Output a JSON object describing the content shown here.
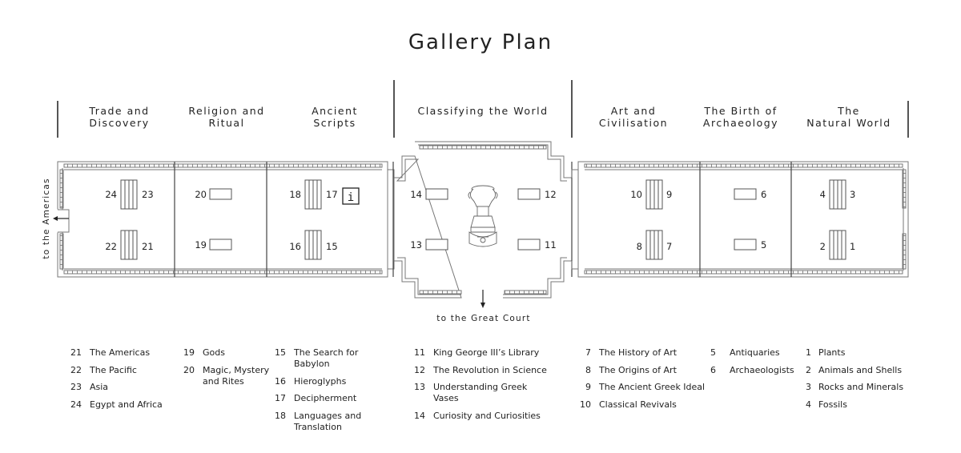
{
  "title": "Gallery Plan",
  "sections": [
    {
      "id": "trade",
      "line1": "Trade and",
      "line2": "Discovery"
    },
    {
      "id": "religion",
      "line1": "Religion and",
      "line2": "Ritual"
    },
    {
      "id": "scripts",
      "line1": "Ancient",
      "line2": "Scripts"
    },
    {
      "id": "classifying",
      "line1": "Classifying the World",
      "line2": ""
    },
    {
      "id": "art",
      "line1": "Art and",
      "line2": "Civilisation"
    },
    {
      "id": "archaeology",
      "line1": "The Birth of",
      "line2": "Archaeology"
    },
    {
      "id": "natural",
      "line1": "The",
      "line2": "Natural World"
    }
  ],
  "directions": {
    "americas": "to the Americas",
    "great_court": "to the Great Court"
  },
  "info_symbol": "i",
  "case_numbers": [
    "24",
    "23",
    "22",
    "21",
    "20",
    "19",
    "18",
    "17",
    "16",
    "15",
    "14",
    "13",
    "12",
    "11",
    "10",
    "9",
    "8",
    "7",
    "6",
    "5",
    "4",
    "3",
    "2",
    "1"
  ],
  "legend_columns": [
    [
      {
        "num": "21",
        "label": "The Americas"
      },
      {
        "num": "22",
        "label": "The Pacific"
      },
      {
        "num": "23",
        "label": "Asia"
      },
      {
        "num": "24",
        "label": "Egypt and Africa"
      }
    ],
    [
      {
        "num": "19",
        "label": "Gods"
      },
      {
        "num": "20",
        "label": "Magic, Mystery and Rites"
      }
    ],
    [
      {
        "num": "15",
        "label": "The Search for Babylon"
      },
      {
        "num": "16",
        "label": "Hieroglyphs"
      },
      {
        "num": "17",
        "label": "Decipherment"
      },
      {
        "num": "18",
        "label": "Languages and Translation"
      }
    ],
    [
      {
        "num": "11",
        "label": "King George III’s Library"
      },
      {
        "num": "12",
        "label": "The Revolution in Science"
      },
      {
        "num": "13",
        "label": "Understanding Greek Vases"
      },
      {
        "num": "14",
        "label": "Curiosity and Curiosities"
      }
    ],
    [
      {
        "num": "7",
        "label": "The History of Art"
      },
      {
        "num": "8",
        "label": "The Origins of Art"
      },
      {
        "num": "9",
        "label": "The Ancient Greek Ideal"
      },
      {
        "num": "10",
        "label": "Classical Revivals"
      }
    ],
    [
      {
        "num": "5",
        "label": "Antiquaries"
      },
      {
        "num": "6",
        "label": "Archaeologists"
      }
    ],
    [
      {
        "num": "1",
        "label": "Plants"
      },
      {
        "num": "2",
        "label": "Animals and Shells"
      },
      {
        "num": "3",
        "label": "Rocks and Minerals"
      },
      {
        "num": "4",
        "label": "Fossils"
      }
    ]
  ]
}
